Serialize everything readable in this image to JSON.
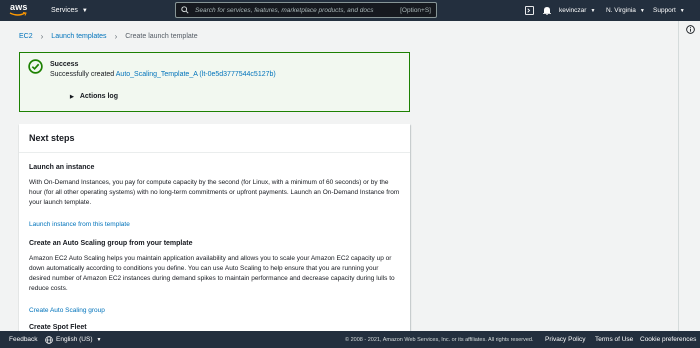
{
  "topnav": {
    "logo_text": "aws",
    "services_label": "Services",
    "search_placeholder": "Search for services, features, marketplace products, and docs",
    "search_shortcut": "[Option+S]",
    "user_label": "kevinczar",
    "region_label": "N. Virginia",
    "support_label": "Support"
  },
  "breadcrumb": {
    "items": [
      "EC2",
      "Launch templates",
      "Create launch template"
    ]
  },
  "flash": {
    "title": "Success",
    "message_prefix": "Successfully created ",
    "template_link": "Auto_Scaling_Template_A (lt-0e5d3777544c5127b)",
    "actions_log": "Actions log",
    "color": "#1d8102"
  },
  "next_steps": {
    "title": "Next steps",
    "sections": [
      {
        "heading": "Launch an instance",
        "body": "With On-Demand Instances, you pay for compute capacity by the second (for Linux, with a minimum of 60 seconds) or by the hour (for all other operating systems) with no long-term commitments or upfront payments. Launch an On-Demand Instance from your launch template.",
        "link": "Launch instance from this template"
      },
      {
        "heading": "Create an Auto Scaling group from your template",
        "body": "Amazon EC2 Auto Scaling helps you maintain application availability and allows you to scale your Amazon EC2 capacity up or down automatically according to conditions you define. You can use Auto Scaling to help ensure that you are running your desired number of Amazon EC2 instances during demand spikes to maintain performance and decrease capacity during lulls to reduce costs.",
        "link": "Create Auto Scaling group"
      },
      {
        "heading": "Create Spot Fleet"
      }
    ]
  },
  "footer": {
    "feedback": "Feedback",
    "language": "English (US)",
    "copyright": "© 2008 - 2021, Amazon Web Services, Inc. or its affiliates. All rights reserved.",
    "privacy": "Privacy Policy",
    "terms": "Terms of Use",
    "cookies": "Cookie preferences"
  },
  "colors": {
    "nav_bg": "#232f3e",
    "link": "#0073bb",
    "aws_orange": "#ff9900"
  }
}
